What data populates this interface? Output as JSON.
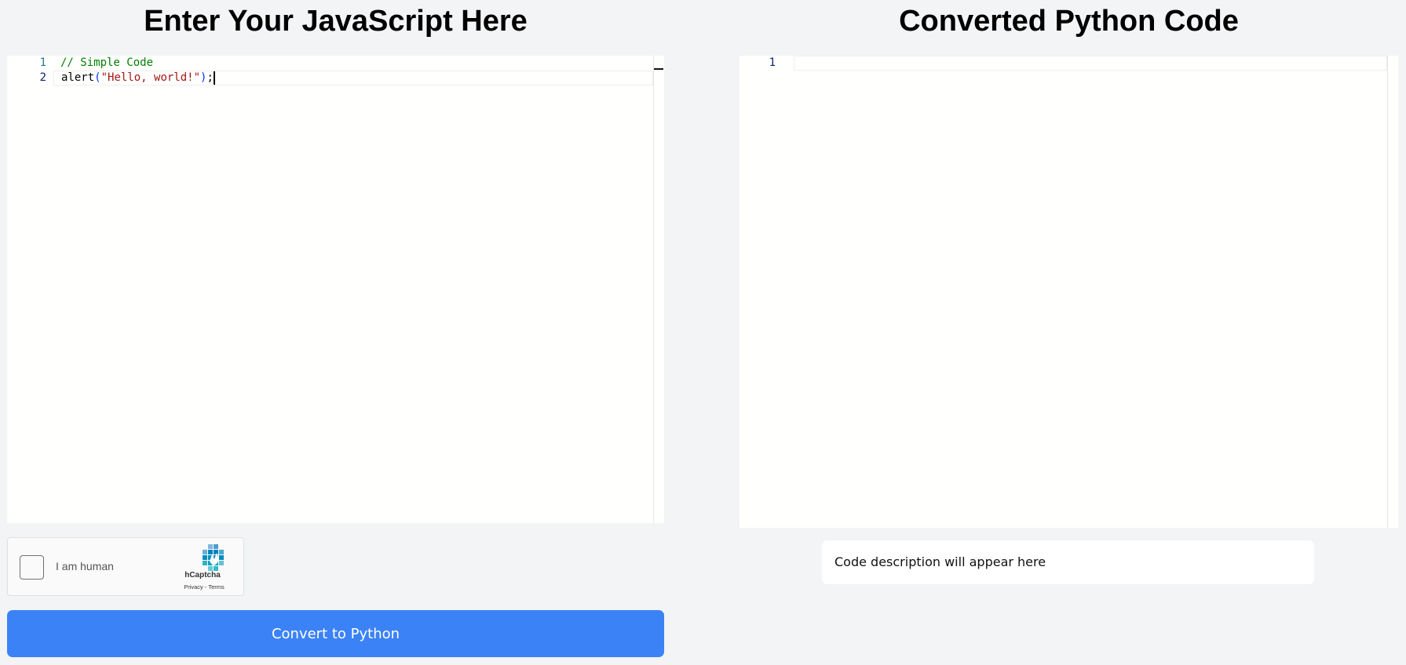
{
  "left_panel": {
    "title": "Enter Your JavaScript Here",
    "editor": {
      "line_numbers": [
        "1",
        "2"
      ],
      "line1_comment": "// Simple Code",
      "line2_fn": "alert",
      "line2_open": "(",
      "line2_string": "\"Hello, world!\"",
      "line2_close": ")",
      "line2_semicolon": ";"
    }
  },
  "right_panel": {
    "title": "Converted Python Code",
    "editor": {
      "line_numbers": [
        "1"
      ]
    },
    "description": "Code description will appear here"
  },
  "captcha": {
    "label": "I am human",
    "brand": "hCaptcha",
    "links": "Privacy - Terms"
  },
  "convert_button": {
    "label": "Convert to Python",
    "color": "#3b82f6"
  },
  "colors": {
    "background": "#f3f4f6",
    "comment": "#008000",
    "string": "#a31515",
    "line_number": "#237893"
  },
  "icons": {
    "captcha_logo": "hcaptcha-logo-icon"
  }
}
